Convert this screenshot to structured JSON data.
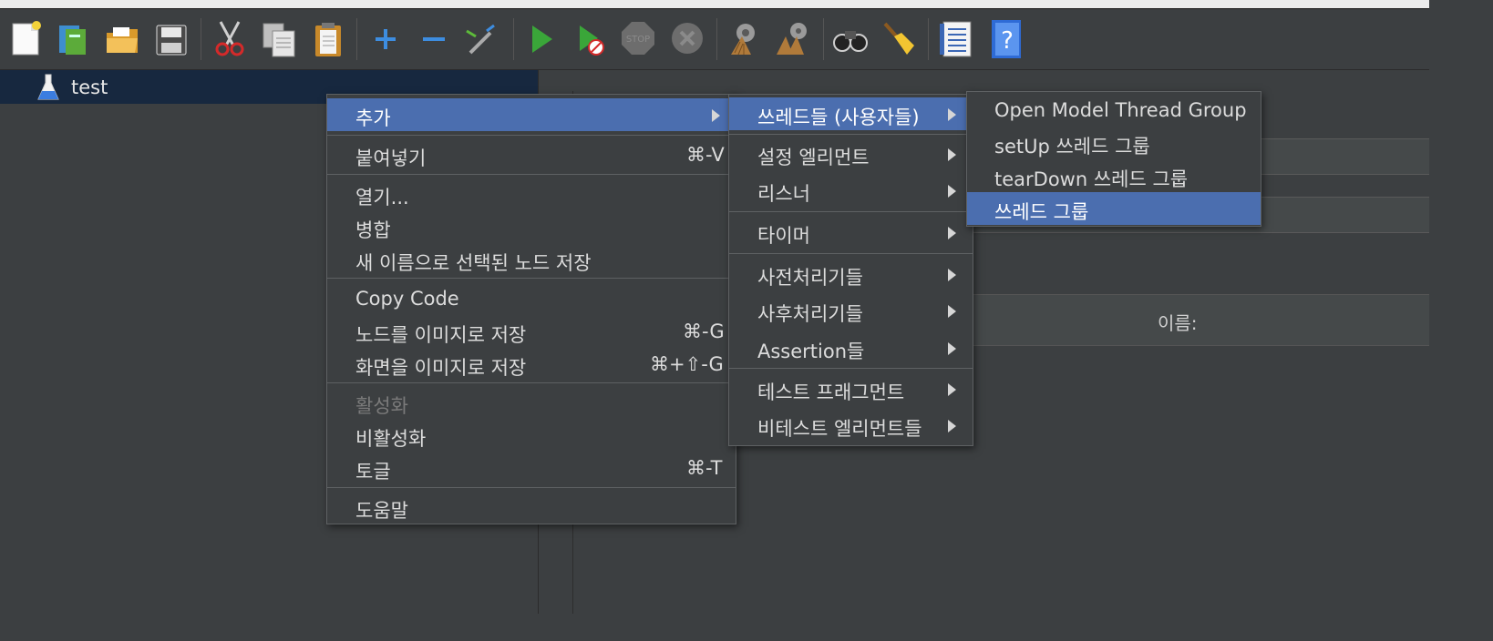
{
  "toolbar": {
    "icons": [
      "new-icon",
      "templates-icon",
      "open-icon",
      "save-icon",
      "cut-icon",
      "copy-icon",
      "paste-icon",
      "expand-icon",
      "collapse-icon",
      "toggle-icon",
      "start-icon",
      "start-no-pauses-icon",
      "stop-icon",
      "shutdown-icon",
      "clear-icon",
      "clear-all-icon",
      "search-icon",
      "reset-search-icon",
      "function-helper-icon",
      "help-icon"
    ]
  },
  "tree": {
    "root_label": "test"
  },
  "right_panel": {
    "name_label": "이름:"
  },
  "context_menu": {
    "add": "추가",
    "paste": "붙여넣기",
    "paste_shortcut": "⌘-V",
    "open": "열기...",
    "merge": "병합",
    "save_as": "새 이름으로 선택된 노드 저장",
    "copy_code": "Copy Code",
    "save_node_image": "노드를 이미지로 저장",
    "save_node_image_shortcut": "⌘-G",
    "save_screen_image": "화면을 이미지로 저장",
    "save_screen_image_shortcut": "⌘+⇧-G",
    "enable": "활성화",
    "disable": "비활성화",
    "toggle": "토글",
    "toggle_shortcut": "⌘-T",
    "help": "도움말"
  },
  "add_submenu": {
    "threads": "쓰레드들 (사용자들)",
    "config": "설정 엘리먼트",
    "listener": "리스너",
    "timer": "타이머",
    "pre_processors": "사전처리기들",
    "post_processors": "사후처리기들",
    "assertions": "Assertion들",
    "test_fragment": "테스트 프래그먼트",
    "non_test_elements": "비테스트 엘리먼트들"
  },
  "threads_submenu": {
    "open_model": "Open Model Thread Group",
    "setup": "setUp 쓰레드 그룹",
    "teardown": "tearDown 쓰레드 그룹",
    "thread_group": "쓰레드 그룹"
  },
  "colors": {
    "selection": "#4b6eaf",
    "background": "#3c3f41",
    "tree_selection": "#17283f"
  }
}
